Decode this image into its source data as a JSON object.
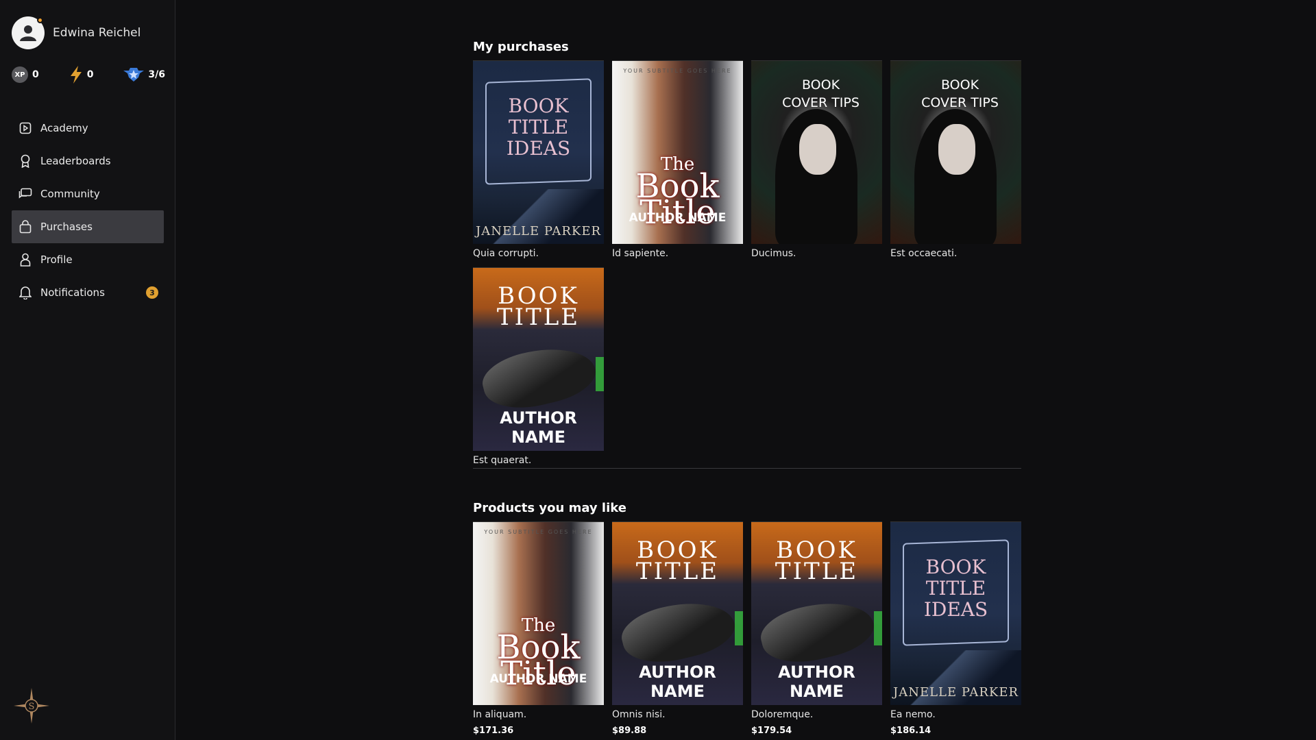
{
  "user": {
    "name": "Edwina Reichel"
  },
  "stats": {
    "xp_label": "XP",
    "xp": "0",
    "energy": "0",
    "rank": "3/6"
  },
  "nav": {
    "items": [
      {
        "label": "Academy",
        "icon": "play-square-icon"
      },
      {
        "label": "Leaderboards",
        "icon": "award-icon"
      },
      {
        "label": "Community",
        "icon": "chat-icon"
      },
      {
        "label": "Purchases",
        "icon": "bag-icon",
        "active": true
      },
      {
        "label": "Profile",
        "icon": "user-icon"
      },
      {
        "label": "Notifications",
        "icon": "bell-icon",
        "badge": "3"
      }
    ]
  },
  "purchases": {
    "title": "My purchases",
    "items": [
      {
        "name": "Quia corrupti.",
        "cover": {
          "title": "BOOK TITLE IDEAS",
          "author": "JANELLE PARKER"
        }
      },
      {
        "name": "Id sapiente.",
        "cover": {
          "subtitle": "YOUR SUBTITLE GOES HERE",
          "title_a": "The",
          "title_b": "Book",
          "title_c": "Title",
          "author": "AUTHOR NAME"
        }
      },
      {
        "name": "Ducimus.",
        "cover": {
          "title": "BOOK COVER TIPS"
        }
      },
      {
        "name": "Est occaecati.",
        "cover": {
          "title": "BOOK COVER TIPS"
        }
      },
      {
        "name": "Est quaerat.",
        "cover": {
          "title": "BOOK TITLE",
          "author": "AUTHOR NAME"
        }
      }
    ]
  },
  "recommended": {
    "title": "Products you may like",
    "items": [
      {
        "name": "In aliquam.",
        "price": "$171.36",
        "cover": {
          "subtitle": "YOUR SUBTITLE GOES HERE",
          "title_a": "The",
          "title_b": "Book",
          "title_c": "Title",
          "author": "AUTHOR NAME"
        }
      },
      {
        "name": "Omnis nisi.",
        "price": "$89.88",
        "cover": {
          "title": "BOOK TITLE",
          "author": "AUTHOR NAME"
        }
      },
      {
        "name": "Doloremque.",
        "price": "$179.54",
        "cover": {
          "title": "BOOK TITLE",
          "author": "AUTHOR NAME"
        }
      },
      {
        "name": "Ea nemo.",
        "price": "$186.14",
        "cover": {
          "title": "BOOK TITLE IDEAS",
          "author": "JANELLE PARKER"
        }
      }
    ]
  },
  "colors": {
    "background": "#0e0e10",
    "sidebar": "#121214",
    "active_nav": "#3b3b40",
    "badge": "#e0a030"
  }
}
